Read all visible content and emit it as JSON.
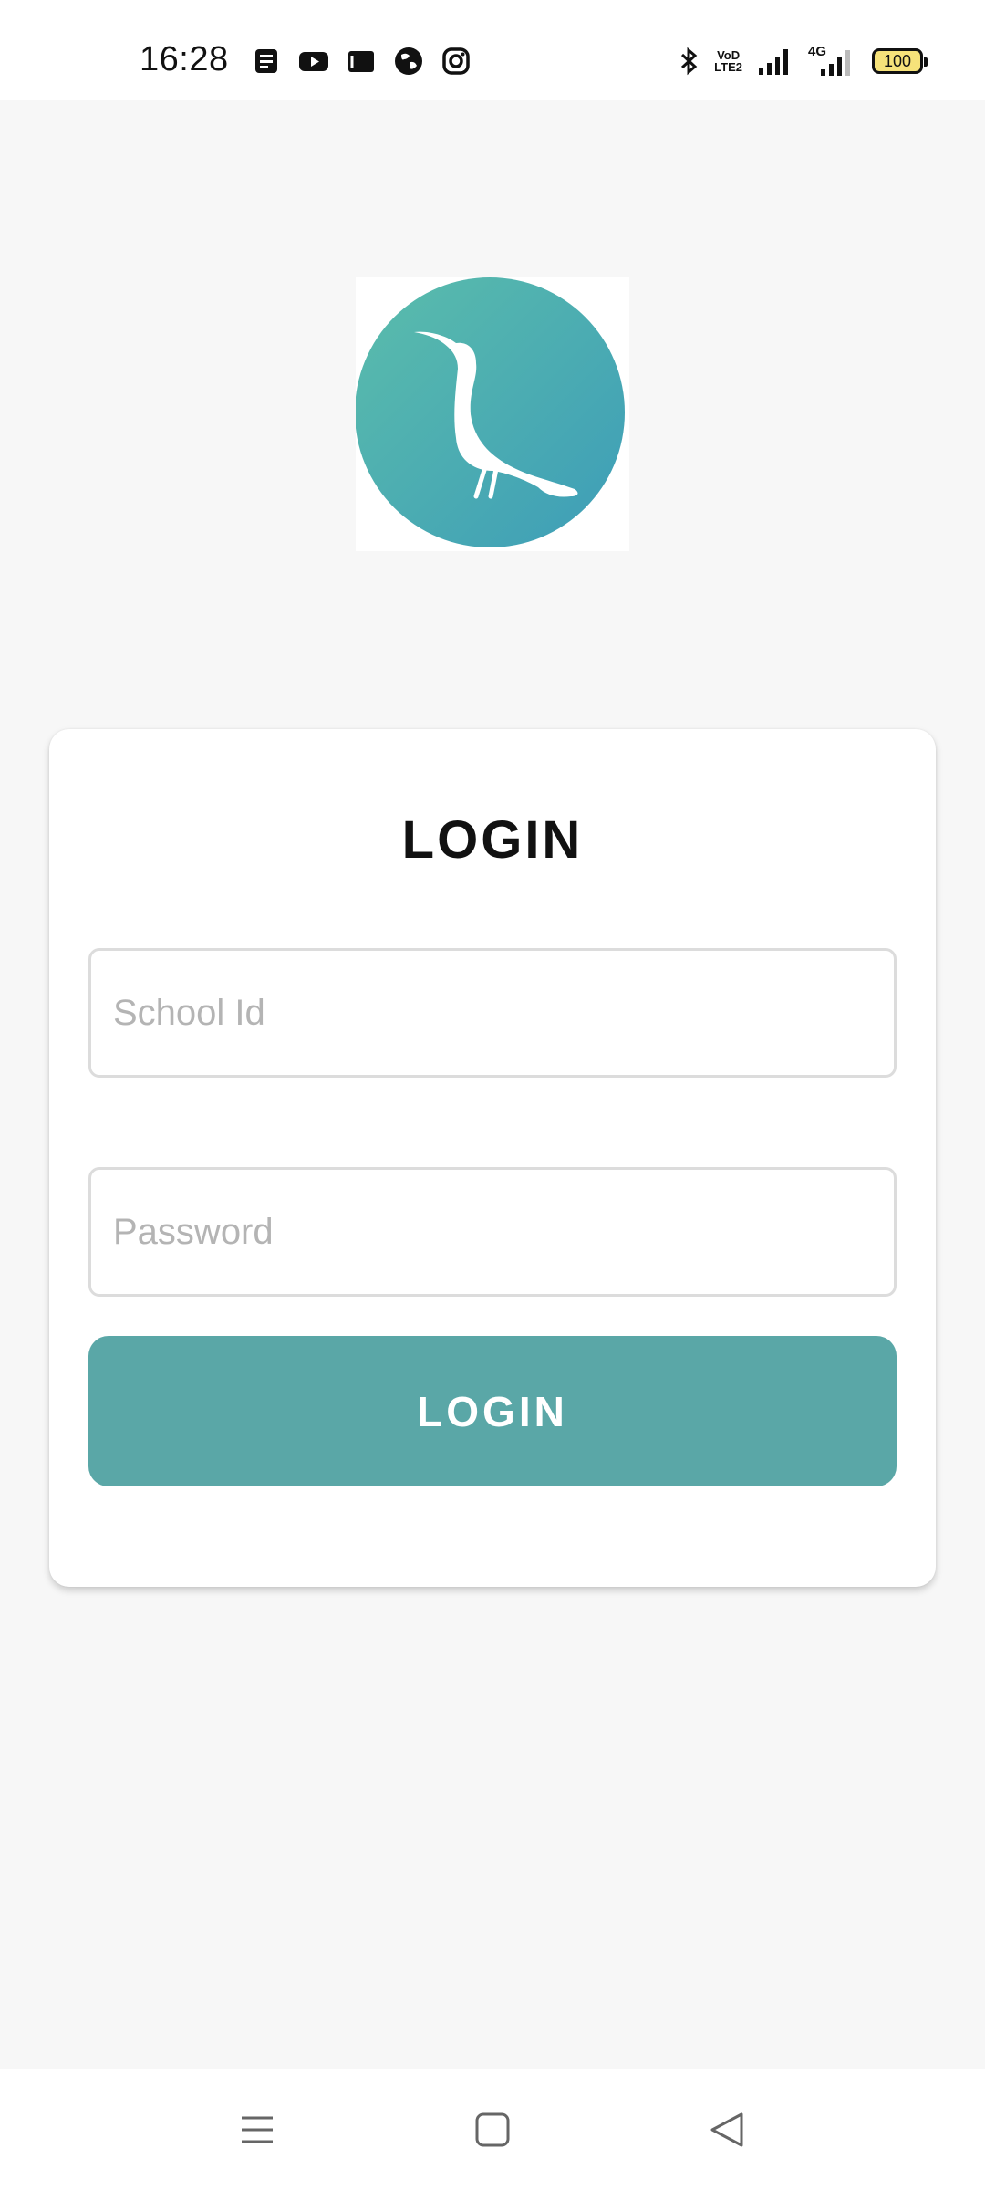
{
  "status_bar": {
    "time": "16:28",
    "notification_icons": [
      "news-icon",
      "youtube-icon",
      "gmail-icon",
      "earth-icon",
      "instagram-icon"
    ],
    "system_icons": [
      "bluetooth-icon",
      "volte-icon",
      "signal-icon",
      "4g-signal-icon",
      "battery-icon"
    ],
    "volte_top": "VoD",
    "volte_bottom": "LTE2",
    "network_label": "4G",
    "battery_level": "100"
  },
  "logo": {
    "icon": "hummingbird-logo-icon",
    "colors": [
      "#5bbdab",
      "#3d9db8"
    ]
  },
  "login_card": {
    "title": "LOGIN",
    "school_id_placeholder": "School Id",
    "school_id_value": "",
    "password_placeholder": "Password",
    "password_value": "",
    "submit_label": "LOGIN"
  },
  "nav_bar": {
    "buttons": [
      "menu-icon",
      "home-icon",
      "back-icon"
    ]
  },
  "colors": {
    "accent": "#5aa7a7",
    "background": "#f7f7f7",
    "card": "#ffffff"
  }
}
